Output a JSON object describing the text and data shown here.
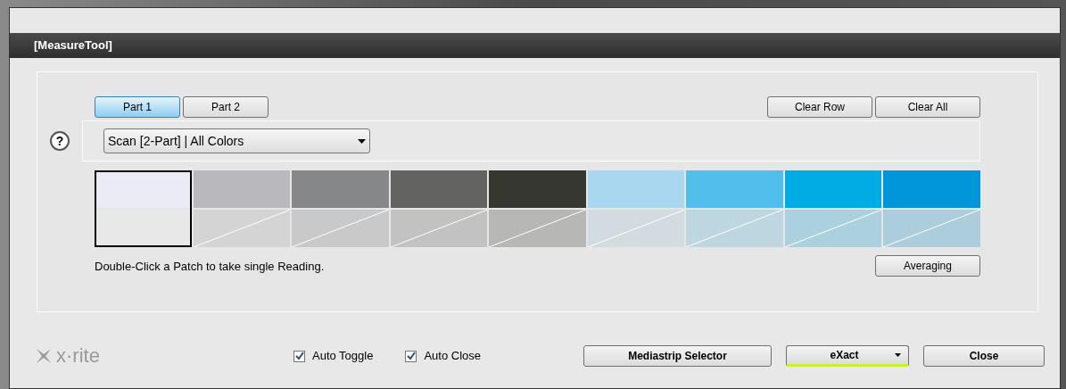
{
  "window": {
    "title": "[MeasureTool]"
  },
  "part_tabs": [
    {
      "label": "Part 1",
      "selected": true
    },
    {
      "label": "Part 2",
      "selected": false
    }
  ],
  "row_buttons": [
    "Clear Row",
    "Clear All"
  ],
  "help": "?",
  "mode_dropdown": {
    "value": "Scan [2-Part] | All Colors"
  },
  "patches": [
    {
      "color": "#ebebf5",
      "measured": false,
      "selected": true
    },
    {
      "color": "#b8b8bd",
      "measured": false,
      "selected": false
    },
    {
      "color": "#868789",
      "measured": false,
      "selected": false
    },
    {
      "color": "#636462",
      "measured": false,
      "selected": false
    },
    {
      "color": "#363731",
      "measured": false,
      "selected": false
    },
    {
      "color": "#a9d7f0",
      "measured": false,
      "selected": false
    },
    {
      "color": "#50bfeb",
      "measured": false,
      "selected": false
    },
    {
      "color": "#00ace3",
      "measured": false,
      "selected": false
    },
    {
      "color": "#0096d9",
      "measured": false,
      "selected": false
    }
  ],
  "hint": "Double-Click a Patch to take single Reading.",
  "averaging_button": "Averaging",
  "logo": "x·rite",
  "options": [
    {
      "label": "Auto Toggle",
      "checked": true
    },
    {
      "label": "Auto Close",
      "checked": true
    }
  ],
  "mediastrip_button": "Mediastrip Selector",
  "device_dropdown": {
    "value": "eXact"
  },
  "close_button": "Close"
}
